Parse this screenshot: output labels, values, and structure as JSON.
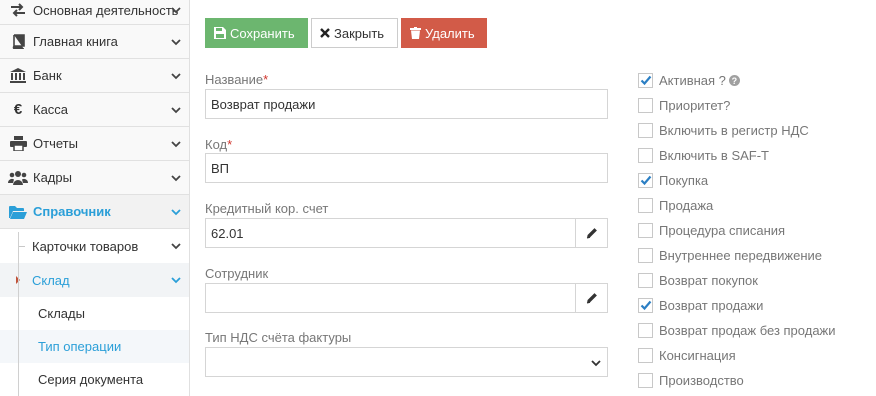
{
  "sidebar": {
    "items": [
      {
        "label": "Основная деятельность",
        "icon": "exchange-icon"
      },
      {
        "label": "Главная книга",
        "icon": "book-icon"
      },
      {
        "label": "Банк",
        "icon": "bank-icon"
      },
      {
        "label": "Касса",
        "icon": "euro-icon"
      },
      {
        "label": "Отчеты",
        "icon": "print-icon"
      },
      {
        "label": "Кадры",
        "icon": "users-icon"
      },
      {
        "label": "Справочник",
        "icon": "folder-open-icon"
      }
    ],
    "sub_items": [
      {
        "label": "Карточки товаров"
      },
      {
        "label": "Склад"
      }
    ],
    "sub_sub_items": [
      {
        "label": "Склады"
      },
      {
        "label": "Тип операции"
      },
      {
        "label": "Серия документа"
      }
    ]
  },
  "toolbar": {
    "save_label": "Сохранить",
    "close_label": "Закрыть",
    "delete_label": "Удалить"
  },
  "form": {
    "name_label": "Название",
    "name_value": "Возврат продажи",
    "code_label": "Код",
    "code_value": "ВП",
    "credit_label": "Кредитный кор. счет",
    "credit_value": "62.01",
    "employee_label": "Сотрудник",
    "employee_value": "",
    "vat_type_label": "Тип НДС счёта фактуры",
    "vat_type_value": "",
    "required_mark": "*"
  },
  "checkboxes": [
    {
      "label": "Активная ?",
      "checked": true
    },
    {
      "label": "Приоритет?",
      "checked": false
    },
    {
      "label": "Включить в регистр НДС",
      "checked": false
    },
    {
      "label": "Включить в SAF-T",
      "checked": false
    },
    {
      "label": "Покупка",
      "checked": true
    },
    {
      "label": "Продажа",
      "checked": false
    },
    {
      "label": "Процедура списания",
      "checked": false
    },
    {
      "label": "Внутреннее передвижение",
      "checked": false
    },
    {
      "label": "Возврат покупок",
      "checked": false
    },
    {
      "label": "Возврат продажи",
      "checked": true
    },
    {
      "label": "Возврат продаж без продажи",
      "checked": false
    },
    {
      "label": "Консигнация",
      "checked": false
    },
    {
      "label": "Производство",
      "checked": false
    }
  ],
  "help_glyph": "?",
  "colors": {
    "accent": "#2b9fd8",
    "save": "#6cb66f",
    "delete": "#d25b48",
    "required": "#d0342c"
  }
}
